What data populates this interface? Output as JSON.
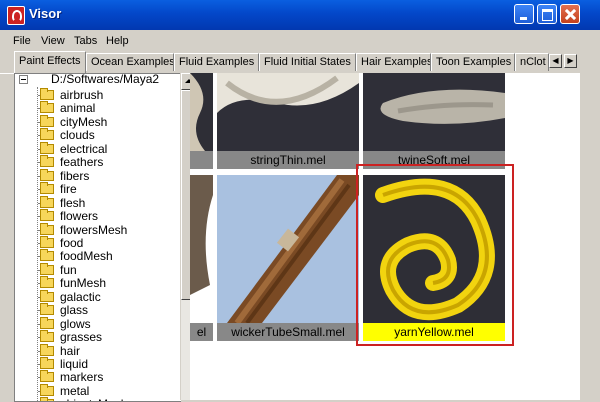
{
  "window": {
    "title": "Visor",
    "controls": [
      "minimize",
      "maximize",
      "close"
    ]
  },
  "menu": [
    "File",
    "View",
    "Tabs",
    "Help"
  ],
  "tabs": [
    {
      "label": "Paint Effects",
      "active": true
    },
    {
      "label": "Ocean Examples"
    },
    {
      "label": "Fluid Examples"
    },
    {
      "label": "Fluid Initial States"
    },
    {
      "label": "Hair Examples"
    },
    {
      "label": "Toon Examples"
    },
    {
      "label": "nClot"
    }
  ],
  "tree": {
    "root": "D:/Softwares/Maya2",
    "items": [
      "airbrush",
      "animal",
      "cityMesh",
      "clouds",
      "electrical",
      "feathers",
      "fibers",
      "fire",
      "flesh",
      "flowers",
      "flowersMesh",
      "food",
      "foodMesh",
      "fun",
      "funMesh",
      "galactic",
      "glass",
      "glows",
      "grasses",
      "hair",
      "liquid",
      "markers",
      "metal",
      "objectsMesh"
    ]
  },
  "thumbnails": [
    {
      "caption": "",
      "image": "rope-coil-partial"
    },
    {
      "caption": "stringThin.mel",
      "image": "white-string-coil"
    },
    {
      "caption": "twineSoft.mel",
      "image": "soft-twine"
    },
    {
      "caption": "el",
      "image": "rope-partial"
    },
    {
      "caption": "wickerTubeSmall.mel",
      "image": "wicker-tube"
    },
    {
      "caption": "yarnYellow.mel",
      "image": "yellow-yarn-swirl",
      "selected": true
    }
  ],
  "colors": {
    "titlebar": "#0347c9",
    "selection": "#ffff00",
    "highlight_frame": "#cc2222"
  }
}
